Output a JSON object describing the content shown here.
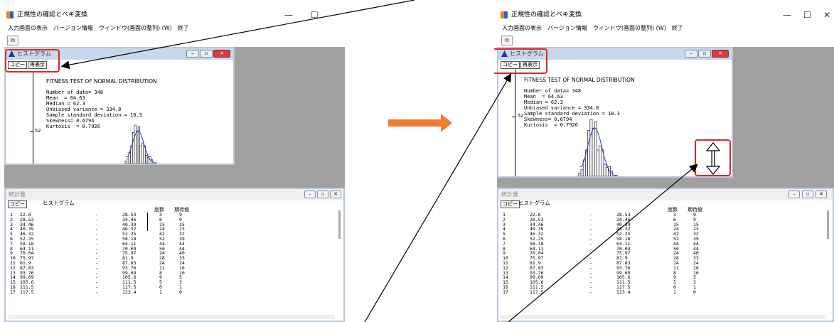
{
  "app": {
    "title": "正規性の確認とベキ変換",
    "menu": [
      "入力画面の表示",
      "バージョン情報",
      "ウィンドウ(画面の整列) (W)",
      "終了"
    ],
    "window_controls": {
      "minimize": "—",
      "maximize": "☐",
      "close": "✕"
    }
  },
  "histogram_window": {
    "title": "ヒストグラム",
    "copy_label": "コピー",
    "redraw_label": "再表示",
    "heading": "FITNESS TEST OF NORMAL DISTRIBUTION",
    "number_of_data": "Number of data= 348",
    "mean": "Mean  = 64.63",
    "median": "Median = 62.3",
    "unbiased_variance": "Unbiased variance = 334.8",
    "sample_sd": "Sample standard deviation = 18.3",
    "skewness": "Skewness= 0.6794",
    "kurtosis": "Kurtosis  = 0.7926",
    "axis_label": "52",
    "bar_values": [
      3,
      6,
      15,
      24,
      42,
      52,
      44,
      50,
      24,
      28,
      24,
      11,
      8,
      9,
      5,
      0,
      1
    ],
    "curve_values": [
      9,
      9,
      15,
      23,
      32,
      39,
      44,
      44,
      40,
      33,
      24,
      16,
      10,
      5,
      3,
      1,
      0
    ]
  },
  "stats_window": {
    "title": "統計量",
    "copy_label": "コピー",
    "table_title": "ヒストグラム",
    "header_freq": "度数",
    "header_expected": "期待値",
    "rows": [
      {
        "n": "1",
        "lo": "22.6",
        "dash": "-",
        "hi": "28.53",
        "freq": "3",
        "exp": "9"
      },
      {
        "n": "2",
        "lo": "28.53",
        "dash": "-",
        "hi": "34.46",
        "freq": "6",
        "exp": "9"
      },
      {
        "n": "3",
        "lo": "34.46",
        "dash": "-",
        "hi": "40.39",
        "freq": "15",
        "exp": "15"
      },
      {
        "n": "4",
        "lo": "40.39",
        "dash": "-",
        "hi": "46.32",
        "freq": "24",
        "exp": "23"
      },
      {
        "n": "5",
        "lo": "46.32",
        "dash": "-",
        "hi": "52.25",
        "freq": "42",
        "exp": "32"
      },
      {
        "n": "6",
        "lo": "52.25",
        "dash": "-",
        "hi": "58.18",
        "freq": "52",
        "exp": "39"
      },
      {
        "n": "7",
        "lo": "58.18",
        "dash": "-",
        "hi": "64.11",
        "freq": "44",
        "exp": "44"
      },
      {
        "n": "8",
        "lo": "64.11",
        "dash": "-",
        "hi": "70.04",
        "freq": "50",
        "exp": "44"
      },
      {
        "n": "9",
        "lo": "70.04",
        "dash": "-",
        "hi": "75.97",
        "freq": "24",
        "exp": "40"
      },
      {
        "n": "10",
        "lo": "75.97",
        "dash": "-",
        "hi": "81.9",
        "freq": "28",
        "exp": "33"
      },
      {
        "n": "11",
        "lo": "81.9",
        "dash": "-",
        "hi": "87.83",
        "freq": "24",
        "exp": "24"
      },
      {
        "n": "12",
        "lo": "87.83",
        "dash": "-",
        "hi": "93.76",
        "freq": "11",
        "exp": "16"
      },
      {
        "n": "13",
        "lo": "93.76",
        "dash": "-",
        "hi": "99.69",
        "freq": "8",
        "exp": "10"
      },
      {
        "n": "14",
        "lo": "99.69",
        "dash": "-",
        "hi": "105.6",
        "freq": "9",
        "exp": "5"
      },
      {
        "n": "15",
        "lo": "105.6",
        "dash": "-",
        "hi": "111.5",
        "freq": "5",
        "exp": "3"
      },
      {
        "n": "16",
        "lo": "111.5",
        "dash": "-",
        "hi": "117.5",
        "freq": "0",
        "exp": "1"
      },
      {
        "n": "17",
        "lo": "117.5",
        "dash": "-",
        "hi": "123.4",
        "freq": "1",
        "exp": "0"
      }
    ]
  },
  "colors": {
    "highlight": "#e0262a",
    "arrow": "#ed7d31",
    "mdi_background": "#a0a0a0",
    "curve": "#1f3fbf"
  }
}
